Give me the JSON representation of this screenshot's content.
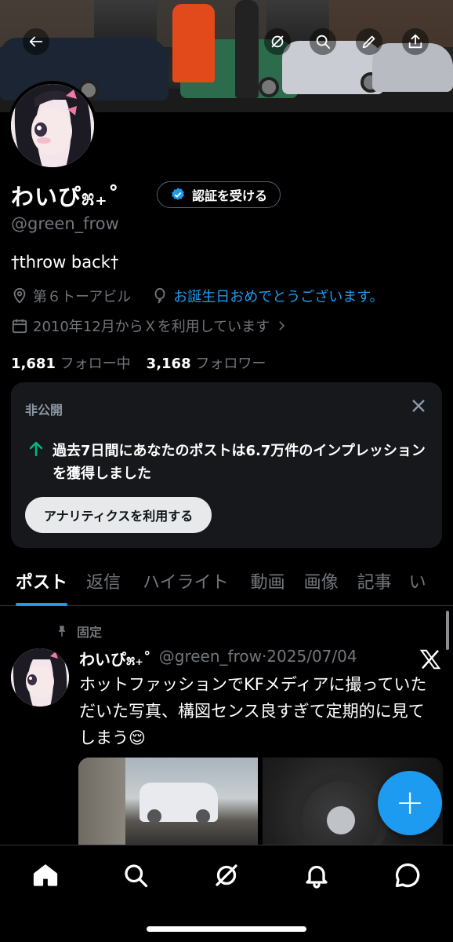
{
  "profile": {
    "display_name": "わいぴ೫₊˚",
    "handle": "@green_frow",
    "verify_label": "認証を受ける",
    "bio": "†throw back†",
    "location": "第６トーアビル",
    "birthday_text": "お誕生日おめでとうございます。",
    "joined": "2010年12月からＸを利用しています",
    "following_count": "1,681",
    "following_label": "フォロー中",
    "followers_count": "3,168",
    "followers_label": "フォロワー"
  },
  "private_card": {
    "label": "非公開",
    "message": "過去7日間にあなたのポストは6.7万件のインプレッションを獲得しました",
    "button": "アナリティクスを利用する",
    "accent_color": "#00ba7c"
  },
  "tabs": [
    "ポスト",
    "返信",
    "ハイライト",
    "動画",
    "画像",
    "記事",
    "い"
  ],
  "post": {
    "pinned_label": "固定",
    "author_name": "わいぴ೫₊˚",
    "author_handle_date": "@green_frow·2025/07/04",
    "text": "ホットファッションでKFメディアに撮っていただいた写真、構図センス良すぎて定期的に見てしまう😌"
  },
  "colors": {
    "accent": "#1d9bf0",
    "background": "#000000"
  },
  "nav_icons": [
    "home-icon",
    "search-icon",
    "grok-icon",
    "notifications-icon",
    "messages-icon"
  ]
}
